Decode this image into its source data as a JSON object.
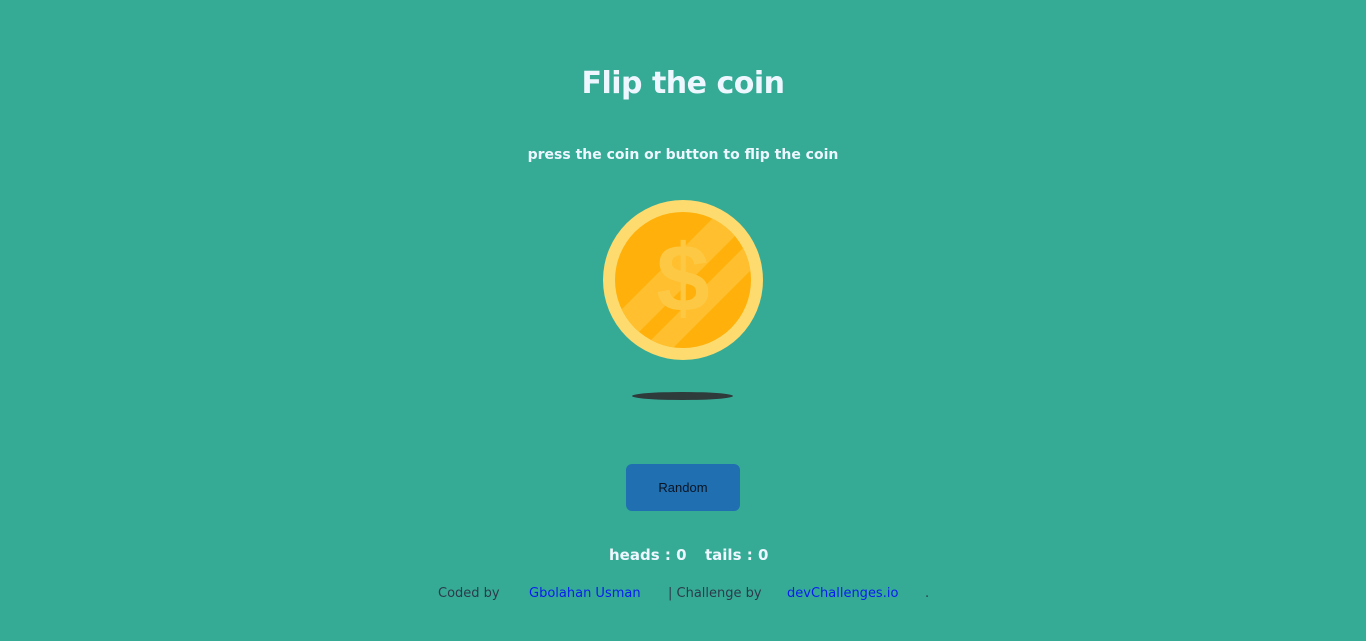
{
  "title": "Flip the coin",
  "subtitle": "press the coin or button to flip the coin",
  "coin": {
    "icon": "dollar-coin-icon",
    "colors": {
      "rim": "#fddb6e",
      "face": "#ffb00a",
      "symbol": "#fdc844"
    }
  },
  "button": {
    "label": "Random",
    "color": "#1f6fb1"
  },
  "scores": {
    "heads_label": "heads : 0",
    "tails_label": "tails : 0"
  },
  "footer": {
    "coded_by": "Coded by",
    "author": "Gbolahan Usman",
    "challenge_by": "| Challenge by",
    "challenge_site": "devChallenges.io",
    "trailing": "."
  },
  "colors": {
    "background": "#35ab96",
    "text": "#eef7ff",
    "link": "#0a1cf0"
  }
}
